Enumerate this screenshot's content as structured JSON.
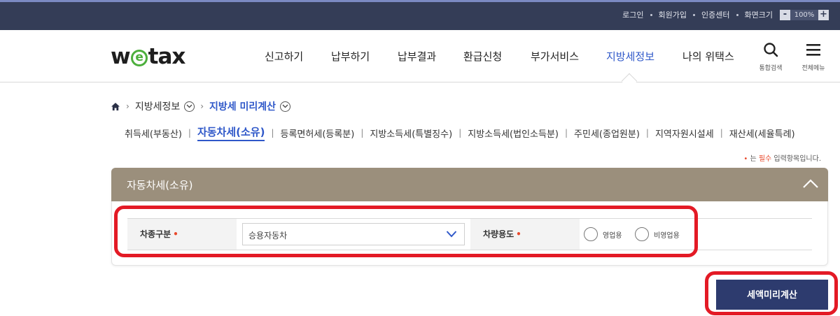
{
  "topbar": {
    "links": [
      "로그인",
      "회원가입",
      "인증센터",
      "화면크기"
    ],
    "zoom": {
      "minus": "-",
      "value": "100%",
      "plus": "+"
    }
  },
  "header": {
    "logo": {
      "w": "w",
      "e": "e",
      "rest": "tax"
    },
    "nav": [
      "신고하기",
      "납부하기",
      "납부결과",
      "환급신청",
      "부가서비스",
      "지방세정보",
      "나의 위택스"
    ],
    "active_nav": "지방세정보",
    "search_label": "통합검색",
    "menu_label": "전체메뉴"
  },
  "breadcrumb": {
    "level1": "지방세정보",
    "level2": "지방세 미리계산"
  },
  "tabs": [
    "취득세(부동산)",
    "자동차세(소유)",
    "등록면허세(등록분)",
    "지방소득세(특별징수)",
    "지방소득세(법인소득분)",
    "주민세(종업원분)",
    "지역자원시설세",
    "재산세(세율특례)"
  ],
  "active_tab": "자동차세(소유)",
  "required_note": {
    "star": "•",
    "prefix": " 는 ",
    "emph": "필수",
    "suffix": " 입력항목입니다."
  },
  "panel": {
    "title": "자동차세(소유)",
    "vehicle_type_label": "차종구분",
    "vehicle_type_value": "승용자동차",
    "usage_label": "차량용도",
    "required_mark": "•",
    "usage_options": [
      "영업용",
      "비영업용"
    ]
  },
  "calc_button": "세액미리계산",
  "colors": {
    "topbar": "#343d57",
    "panel_header": "#9b8f7c",
    "accent_blue": "#2f58c9",
    "button": "#2d3b6e",
    "highlight": "#e31a25"
  }
}
